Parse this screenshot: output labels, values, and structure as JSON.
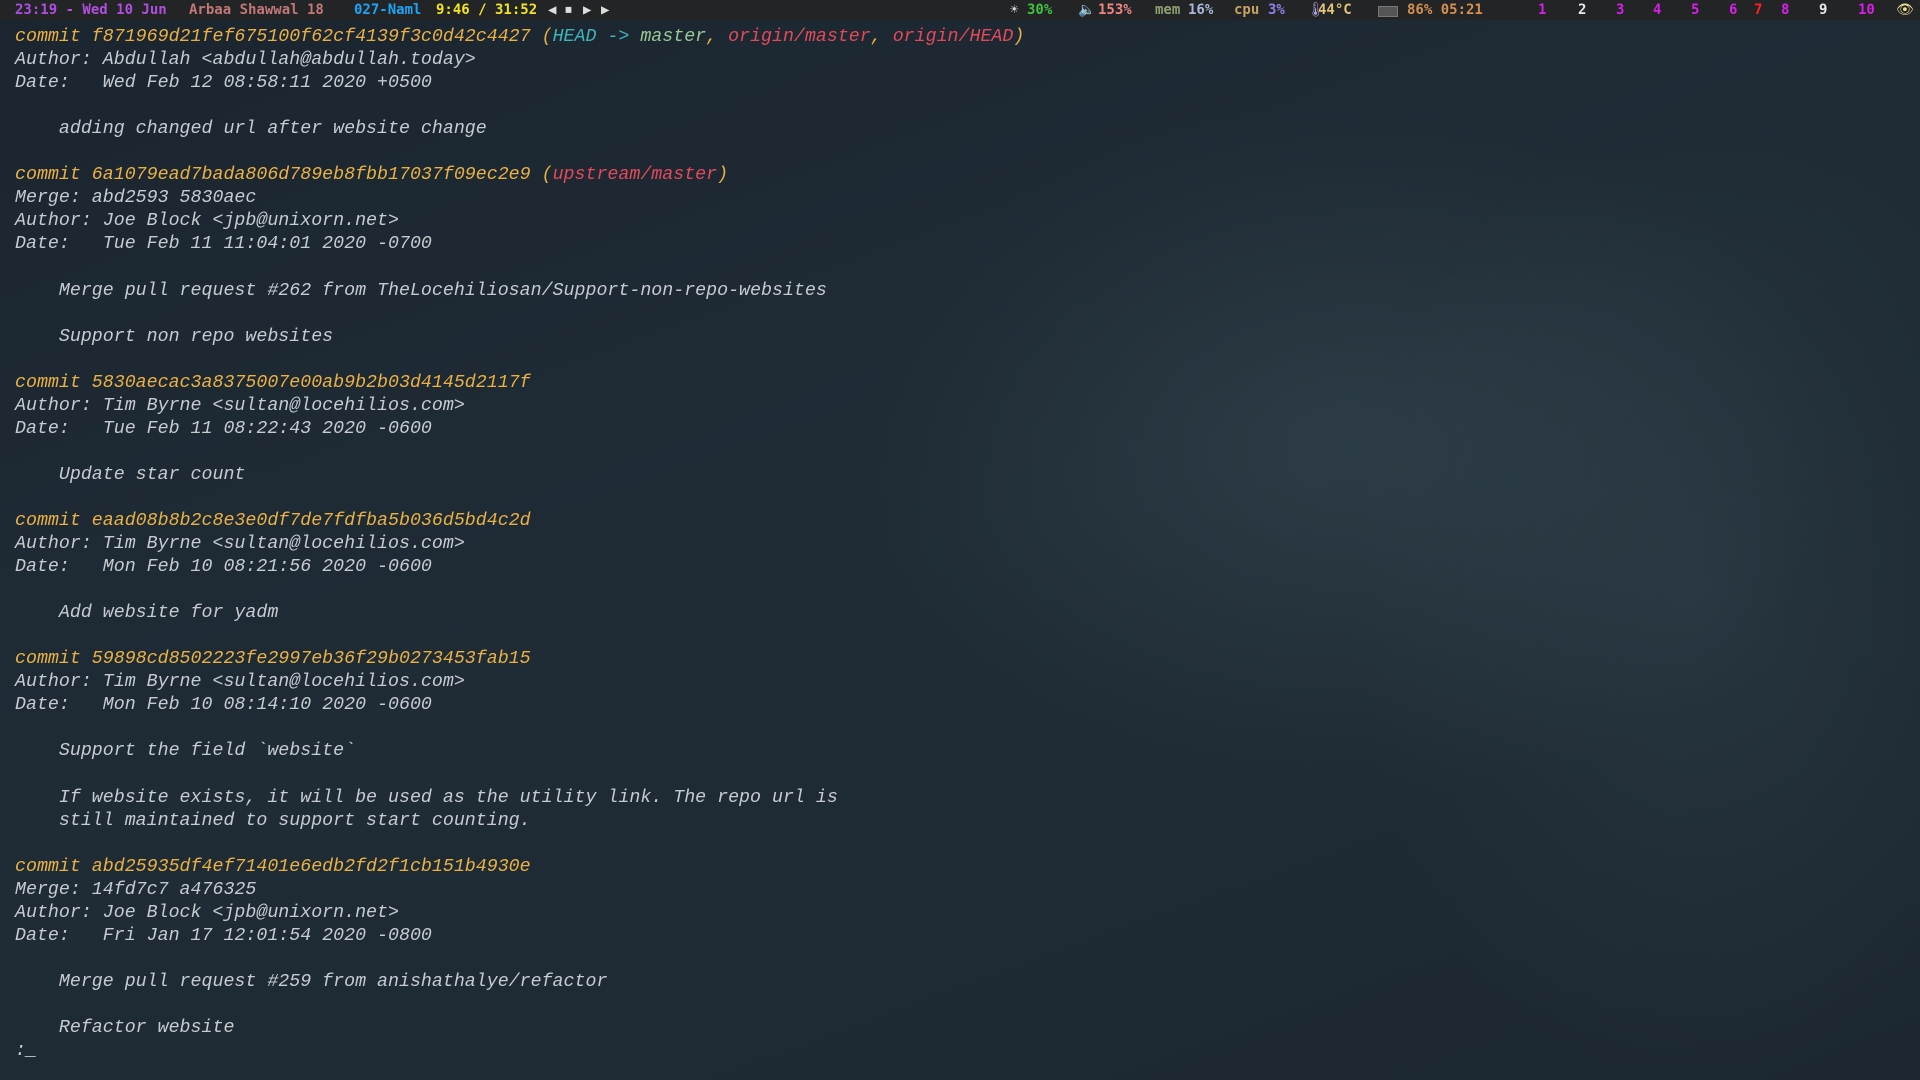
{
  "statusbar": {
    "datetime": "23:19 - Wed 10 Jun",
    "hijri": "Arbaa Shawwal 18",
    "surah": "027-Naml",
    "media_time": "9:46 / 31:52",
    "brightness": "30%",
    "volume": "153%",
    "mem_label": "mem",
    "mem_value": "16%",
    "cpu_label": "cpu",
    "cpu_value": "3%",
    "temperature": "44°C",
    "battery": "86% 05:21",
    "workspaces": [
      "1",
      "2",
      "3",
      "4",
      "5",
      "6",
      "7",
      "8",
      "9",
      "10"
    ],
    "colors": {
      "date": "#b04ee0",
      "hijri": "#c27878",
      "surah": "#1ea3f2",
      "media": "#f2e51e",
      "brightness": "#3fc23f",
      "volume": "#f08585",
      "mem_label": "#8fa070",
      "mem_value": "#a8b8d8",
      "cpu_label": "#c4a460",
      "cpu_value": "#8a84e8",
      "temp": "#e0c27a",
      "battery": "#d4904f",
      "ws": "#d61fe6",
      "ws_white": "#e8e8e8",
      "ws_urgent": "#ff2020"
    }
  },
  "terminal": {
    "colors": {
      "hash": "#e9b143",
      "text": "#c6cbd0",
      "head": "#3fb3b8",
      "branch": "#98c894",
      "remote": "#e24a5a"
    },
    "lines": [
      [
        {
          "t": "commit f871969d21fef675100f62cf4139f3c0d42c4427 (",
          "c": "hash"
        },
        {
          "t": "HEAD -> ",
          "c": "head"
        },
        {
          "t": "master",
          "c": "branch"
        },
        {
          "t": ", ",
          "c": "hash"
        },
        {
          "t": "origin/master",
          "c": "remote"
        },
        {
          "t": ", ",
          "c": "hash"
        },
        {
          "t": "origin/HEAD",
          "c": "remote"
        },
        {
          "t": ")",
          "c": "hash"
        }
      ],
      [
        {
          "t": "Author: Abdullah <abdullah@abdullah.today>",
          "c": "text"
        }
      ],
      [
        {
          "t": "Date:   Wed Feb 12 08:58:11 2020 +0500",
          "c": "text"
        }
      ],
      [],
      [
        {
          "t": "    adding changed url after website change",
          "c": "text"
        }
      ],
      [],
      [
        {
          "t": "commit 6a1079ead7bada806d789eb8fbb17037f09ec2e9 (",
          "c": "hash"
        },
        {
          "t": "upstream/master",
          "c": "remote"
        },
        {
          "t": ")",
          "c": "hash"
        }
      ],
      [
        {
          "t": "Merge: abd2593 5830aec",
          "c": "text"
        }
      ],
      [
        {
          "t": "Author: Joe Block <jpb@unixorn.net>",
          "c": "text"
        }
      ],
      [
        {
          "t": "Date:   Tue Feb 11 11:04:01 2020 -0700",
          "c": "text"
        }
      ],
      [],
      [
        {
          "t": "    Merge pull request #262 from TheLocehiliosan/Support-non-repo-websites",
          "c": "text"
        }
      ],
      [],
      [
        {
          "t": "    Support non repo websites",
          "c": "text"
        }
      ],
      [],
      [
        {
          "t": "commit 5830aecac3a8375007e00ab9b2b03d4145d2117f",
          "c": "hash"
        }
      ],
      [
        {
          "t": "Author: Tim Byrne <sultan@locehilios.com>",
          "c": "text"
        }
      ],
      [
        {
          "t": "Date:   Tue Feb 11 08:22:43 2020 -0600",
          "c": "text"
        }
      ],
      [],
      [
        {
          "t": "    Update star count",
          "c": "text"
        }
      ],
      [],
      [
        {
          "t": "commit eaad08b8b2c8e3e0df7de7fdfba5b036d5bd4c2d",
          "c": "hash"
        }
      ],
      [
        {
          "t": "Author: Tim Byrne <sultan@locehilios.com>",
          "c": "text"
        }
      ],
      [
        {
          "t": "Date:   Mon Feb 10 08:21:56 2020 -0600",
          "c": "text"
        }
      ],
      [],
      [
        {
          "t": "    Add website for yadm",
          "c": "text"
        }
      ],
      [],
      [
        {
          "t": "commit 59898cd8502223fe2997eb36f29b0273453fab15",
          "c": "hash"
        }
      ],
      [
        {
          "t": "Author: Tim Byrne <sultan@locehilios.com>",
          "c": "text"
        }
      ],
      [
        {
          "t": "Date:   Mon Feb 10 08:14:10 2020 -0600",
          "c": "text"
        }
      ],
      [],
      [
        {
          "t": "    Support the field `website`",
          "c": "text"
        }
      ],
      [],
      [
        {
          "t": "    If website exists, it will be used as the utility link. The repo url is",
          "c": "text"
        }
      ],
      [
        {
          "t": "    still maintained to support start counting.",
          "c": "text"
        }
      ],
      [],
      [
        {
          "t": "commit abd25935df4ef71401e6edb2fd2f1cb151b4930e",
          "c": "hash"
        }
      ],
      [
        {
          "t": "Merge: 14fd7c7 a476325",
          "c": "text"
        }
      ],
      [
        {
          "t": "Author: Joe Block <jpb@unixorn.net>",
          "c": "text"
        }
      ],
      [
        {
          "t": "Date:   Fri Jan 17 12:01:54 2020 -0800",
          "c": "text"
        }
      ],
      [],
      [
        {
          "t": "    Merge pull request #259 from anishathalye/refactor",
          "c": "text"
        }
      ],
      [],
      [
        {
          "t": "    Refactor website",
          "c": "text"
        }
      ],
      [
        {
          "t": ":_",
          "c": "text"
        }
      ]
    ]
  }
}
